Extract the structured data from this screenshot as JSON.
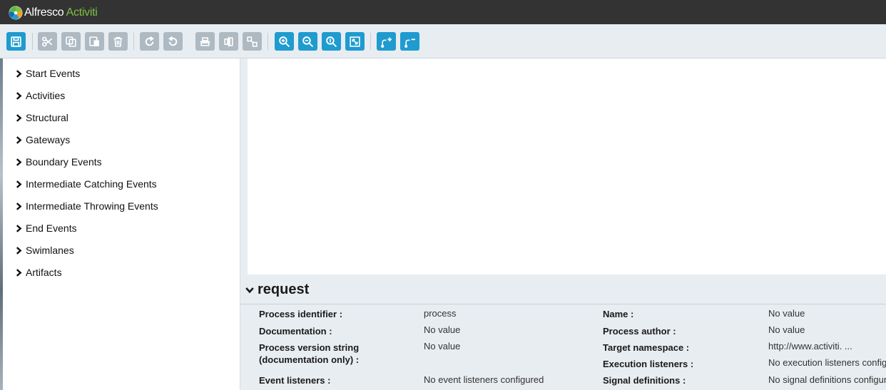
{
  "app": {
    "brand_part1": "Alfresco",
    "brand_part2": "Activiti",
    "colors": {
      "topbar": "#333333",
      "accent": "#1f9bd0",
      "disabled": "#aeb9c2",
      "brand_green": "#7cc142",
      "panel": "#e8edf1"
    }
  },
  "toolbar": {
    "buttons": [
      {
        "name": "save",
        "icon": "save-icon",
        "state": "active"
      },
      {
        "name": "cut",
        "icon": "scissors-icon",
        "state": "disabled"
      },
      {
        "name": "copy",
        "icon": "copy-icon",
        "state": "disabled"
      },
      {
        "name": "paste",
        "icon": "paste-icon",
        "state": "disabled"
      },
      {
        "name": "delete",
        "icon": "trash-icon",
        "state": "disabled"
      },
      {
        "name": "redo",
        "icon": "redo-icon",
        "state": "disabled"
      },
      {
        "name": "undo",
        "icon": "undo-icon",
        "state": "disabled"
      },
      {
        "name": "align-horizontal",
        "icon": "align-horizontal-icon",
        "state": "disabled"
      },
      {
        "name": "align-vertical",
        "icon": "align-vertical-icon",
        "state": "disabled"
      },
      {
        "name": "same-size",
        "icon": "same-size-icon",
        "state": "disabled"
      },
      {
        "name": "zoom-in",
        "icon": "zoom-in-icon",
        "state": "active"
      },
      {
        "name": "zoom-out",
        "icon": "zoom-out-icon",
        "state": "active"
      },
      {
        "name": "zoom-actual",
        "icon": "zoom-actual-icon",
        "state": "active"
      },
      {
        "name": "zoom-fit",
        "icon": "zoom-fit-icon",
        "state": "active"
      },
      {
        "name": "add-bendpoint",
        "icon": "add-bendpoint-icon",
        "state": "active"
      },
      {
        "name": "remove-bendpoint",
        "icon": "remove-bendpoint-icon",
        "state": "active"
      }
    ]
  },
  "palette": {
    "groups": [
      {
        "label": "Start Events"
      },
      {
        "label": "Activities"
      },
      {
        "label": "Structural"
      },
      {
        "label": "Gateways"
      },
      {
        "label": "Boundary Events"
      },
      {
        "label": "Intermediate Catching Events"
      },
      {
        "label": "Intermediate Throwing Events"
      },
      {
        "label": "End Events"
      },
      {
        "label": "Swimlanes"
      },
      {
        "label": "Artifacts"
      }
    ]
  },
  "properties": {
    "title": "request",
    "fields": {
      "process_identifier": {
        "label": "Process identifier :",
        "value": "process"
      },
      "documentation": {
        "label": "Documentation :",
        "value": "No value"
      },
      "process_version_line1": "Process version string",
      "process_version_line2": "(documentation only) :",
      "process_version_value": "No value",
      "event_listeners": {
        "label": "Event listeners :",
        "value": "No event listeners configured"
      },
      "name": {
        "label": "Name :",
        "value": "No value"
      },
      "process_author": {
        "label": "Process author :",
        "value": "No value"
      },
      "target_namespace": {
        "label": "Target namespace :",
        "value": "http://www.activiti. ..."
      },
      "execution_listeners": {
        "label": "Execution listeners :",
        "value": "No execution listeners configured"
      },
      "signal_definitions": {
        "label": "Signal definitions :",
        "value": "No signal definitions configured"
      }
    }
  }
}
